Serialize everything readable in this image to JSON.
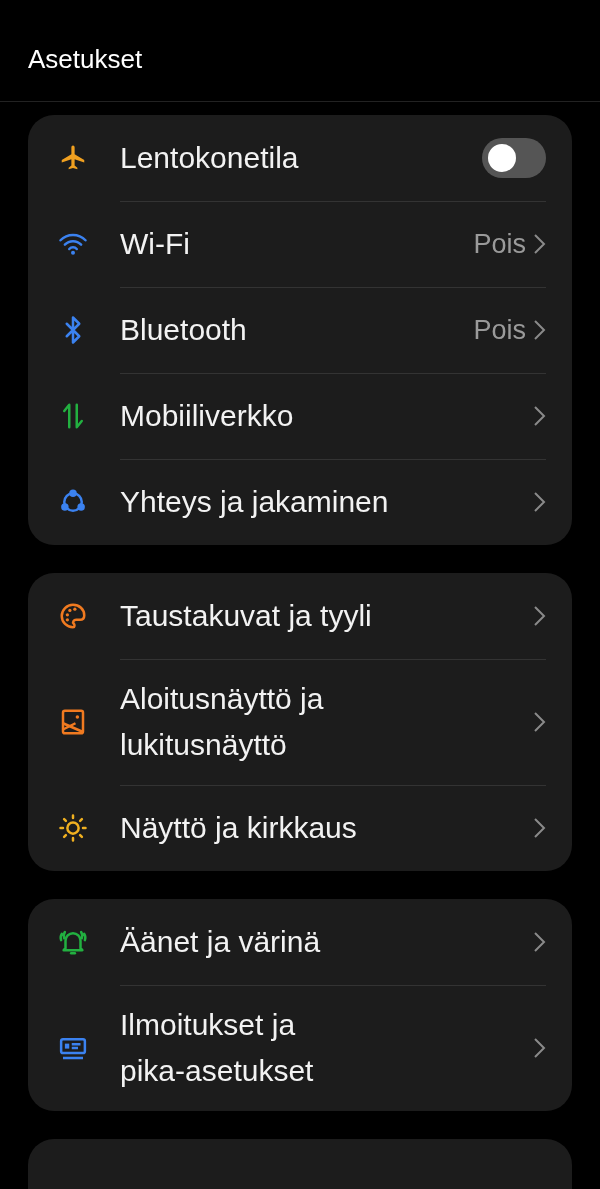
{
  "header": {
    "title": "Asetukset"
  },
  "groups": [
    {
      "items": [
        {
          "kind": "toggle",
          "label": "Lentokonetila",
          "on": false
        },
        {
          "kind": "link",
          "label": "Wi-Fi",
          "value": "Pois"
        },
        {
          "kind": "link",
          "label": "Bluetooth",
          "value": "Pois"
        },
        {
          "kind": "link",
          "label": "Mobiiliverkko"
        },
        {
          "kind": "link",
          "label": "Yhteys ja jakaminen"
        }
      ]
    },
    {
      "items": [
        {
          "kind": "link",
          "label": "Taustakuvat ja tyyli"
        },
        {
          "kind": "link",
          "label": "Aloitusnäyttö ja lukitusnäyttö"
        },
        {
          "kind": "link",
          "label": "Näyttö ja kirkkaus"
        }
      ]
    },
    {
      "items": [
        {
          "kind": "link",
          "label": "Äänet ja värinä"
        },
        {
          "kind": "link",
          "label": "Ilmoitukset ja pika-asetukset"
        }
      ]
    }
  ]
}
